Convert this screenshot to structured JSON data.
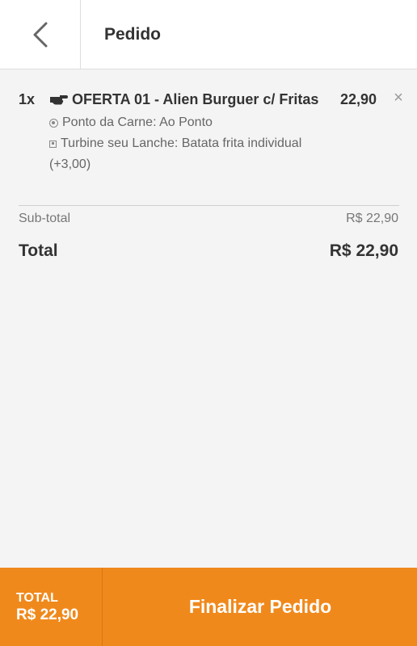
{
  "header": {
    "back_icon": "chevron-left-icon",
    "title": "Pedido"
  },
  "order": {
    "items": [
      {
        "quantity": "1x",
        "icon": "pointing-hand-icon",
        "name": "OFERTA 01 - Alien Burguer c/ Fritas",
        "price": "22,90",
        "remove_icon": "close-icon",
        "options": [
          {
            "icon": "radio-icon",
            "text": "Ponto da Carne: Ao Ponto"
          },
          {
            "icon": "checkbox-icon",
            "text": "Turbine seu Lanche: Batata frita individual"
          },
          {
            "text": "(+3,00)"
          }
        ]
      }
    ],
    "subtotal_label": "Sub-total",
    "subtotal_value": "R$ 22,90",
    "total_label": "Total",
    "total_value": "R$ 22,90"
  },
  "footer": {
    "total_label": "TOTAL",
    "total_value": "R$ 22,90",
    "finalize_label": "Finalizar Pedido"
  },
  "colors": {
    "accent": "#f0891b",
    "background": "#f4f4f4"
  }
}
